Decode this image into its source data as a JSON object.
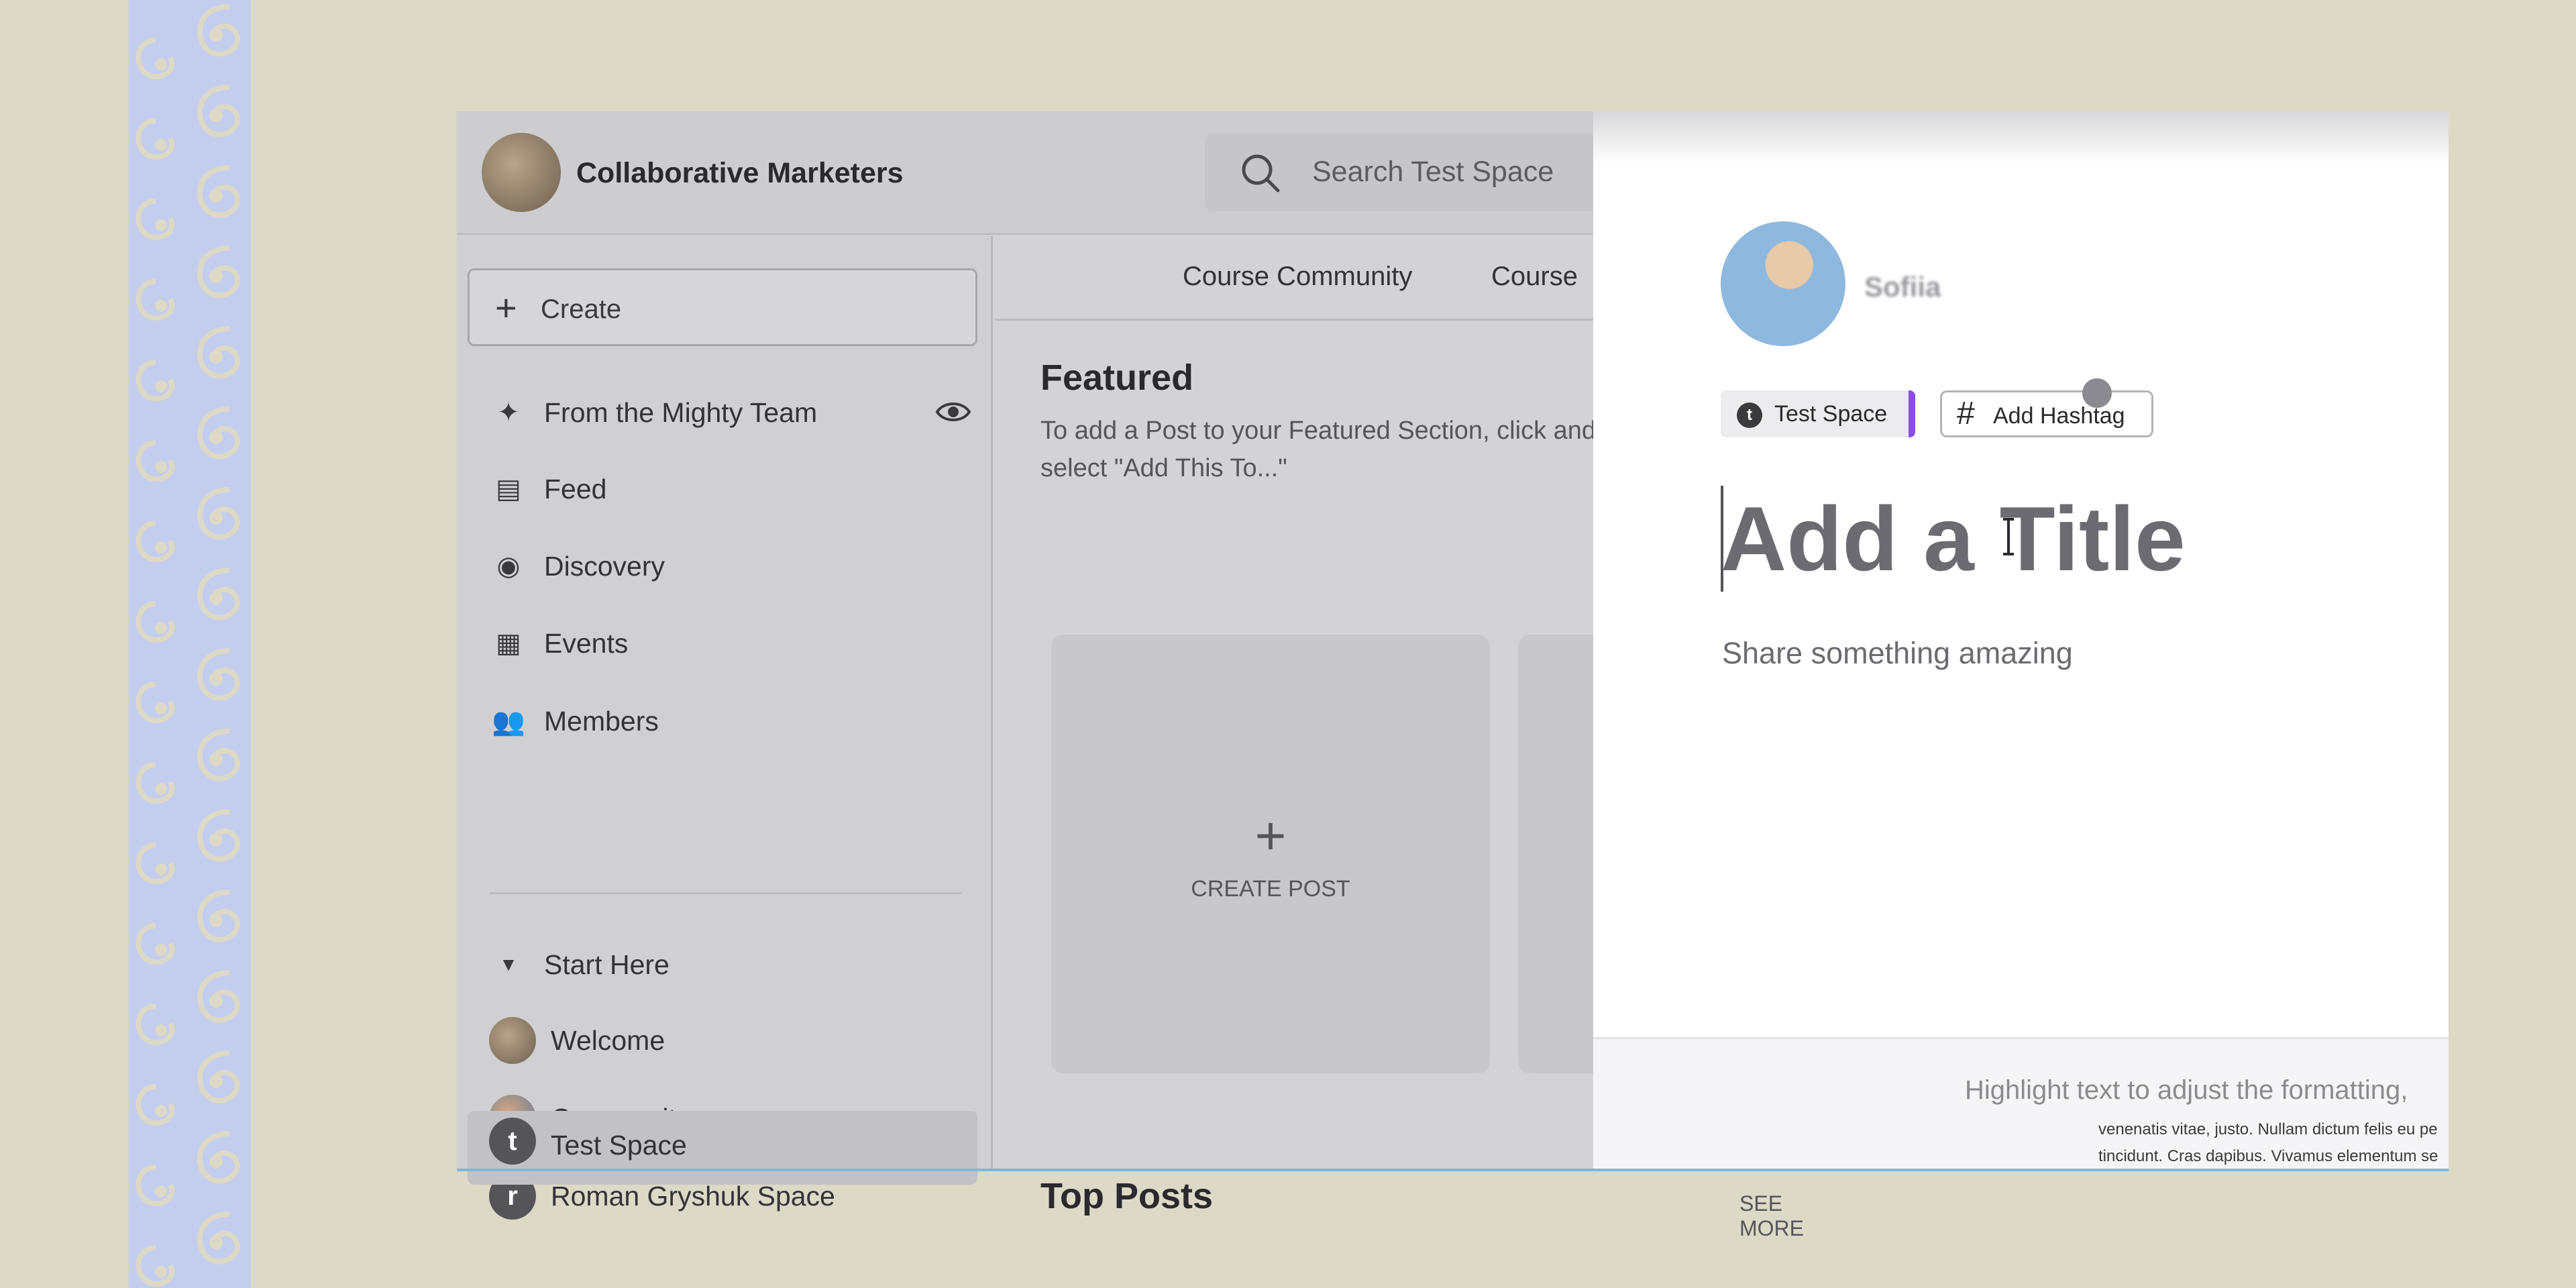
{
  "app": {
    "title": "Collaborative Marketers",
    "search_placeholder": "Search Test Space"
  },
  "sidebar": {
    "create_label": "Create",
    "items": [
      {
        "label": "From the Mighty Team",
        "icon": "sparkle-icon"
      },
      {
        "label": "Feed",
        "icon": "feed-icon"
      },
      {
        "label": "Discovery",
        "icon": "compass-icon"
      },
      {
        "label": "Events",
        "icon": "calendar-icon"
      },
      {
        "label": "Members",
        "icon": "members-icon"
      }
    ],
    "section_label": "Start Here",
    "spaces": [
      {
        "label": "Welcome"
      },
      {
        "label": "Community"
      },
      {
        "label": "Roman Gryshuk Space",
        "initial": "r"
      },
      {
        "label": "Test Space",
        "initial": "t"
      }
    ]
  },
  "main": {
    "tabs": [
      "Course Community",
      "Course"
    ],
    "featured_title": "Featured",
    "featured_desc": "To add a Post to your Featured Section, click and select \"Add This To...\"",
    "create_post_label": "CREATE POST",
    "top_posts_title": "Top Posts",
    "see_more_label": "SEE MORE"
  },
  "composer": {
    "user_name": "Sofiia",
    "space_tag": "Test Space",
    "space_initial": "t",
    "hashtag_label": "Add Hashtag",
    "title_placeholder": "Add a Title",
    "body_placeholder": "Share something amazing",
    "footer_hint": "Highlight text to adjust the formatting,",
    "lorem_line1": "venenatis vitae, justo. Nullam dictum felis eu pe",
    "lorem_line2": "tincidunt. Cras dapibus. Vivamus elementum se"
  },
  "colors": {
    "background": "#ddd9c7",
    "pattern": "#c3cdee",
    "accent_purple": "#8b4de8"
  }
}
